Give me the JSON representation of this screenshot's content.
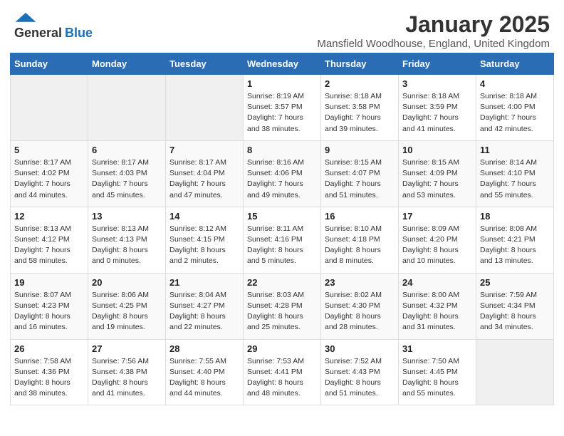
{
  "header": {
    "logo_general": "General",
    "logo_blue": "Blue",
    "title": "January 2025",
    "subtitle": "Mansfield Woodhouse, England, United Kingdom"
  },
  "days_of_week": [
    "Sunday",
    "Monday",
    "Tuesday",
    "Wednesday",
    "Thursday",
    "Friday",
    "Saturday"
  ],
  "weeks": [
    [
      {
        "day": "",
        "info": ""
      },
      {
        "day": "",
        "info": ""
      },
      {
        "day": "",
        "info": ""
      },
      {
        "day": "1",
        "info": "Sunrise: 8:19 AM\nSunset: 3:57 PM\nDaylight: 7 hours\nand 38 minutes."
      },
      {
        "day": "2",
        "info": "Sunrise: 8:18 AM\nSunset: 3:58 PM\nDaylight: 7 hours\nand 39 minutes."
      },
      {
        "day": "3",
        "info": "Sunrise: 8:18 AM\nSunset: 3:59 PM\nDaylight: 7 hours\nand 41 minutes."
      },
      {
        "day": "4",
        "info": "Sunrise: 8:18 AM\nSunset: 4:00 PM\nDaylight: 7 hours\nand 42 minutes."
      }
    ],
    [
      {
        "day": "5",
        "info": "Sunrise: 8:17 AM\nSunset: 4:02 PM\nDaylight: 7 hours\nand 44 minutes."
      },
      {
        "day": "6",
        "info": "Sunrise: 8:17 AM\nSunset: 4:03 PM\nDaylight: 7 hours\nand 45 minutes."
      },
      {
        "day": "7",
        "info": "Sunrise: 8:17 AM\nSunset: 4:04 PM\nDaylight: 7 hours\nand 47 minutes."
      },
      {
        "day": "8",
        "info": "Sunrise: 8:16 AM\nSunset: 4:06 PM\nDaylight: 7 hours\nand 49 minutes."
      },
      {
        "day": "9",
        "info": "Sunrise: 8:15 AM\nSunset: 4:07 PM\nDaylight: 7 hours\nand 51 minutes."
      },
      {
        "day": "10",
        "info": "Sunrise: 8:15 AM\nSunset: 4:09 PM\nDaylight: 7 hours\nand 53 minutes."
      },
      {
        "day": "11",
        "info": "Sunrise: 8:14 AM\nSunset: 4:10 PM\nDaylight: 7 hours\nand 55 minutes."
      }
    ],
    [
      {
        "day": "12",
        "info": "Sunrise: 8:13 AM\nSunset: 4:12 PM\nDaylight: 7 hours\nand 58 minutes."
      },
      {
        "day": "13",
        "info": "Sunrise: 8:13 AM\nSunset: 4:13 PM\nDaylight: 8 hours\nand 0 minutes."
      },
      {
        "day": "14",
        "info": "Sunrise: 8:12 AM\nSunset: 4:15 PM\nDaylight: 8 hours\nand 2 minutes."
      },
      {
        "day": "15",
        "info": "Sunrise: 8:11 AM\nSunset: 4:16 PM\nDaylight: 8 hours\nand 5 minutes."
      },
      {
        "day": "16",
        "info": "Sunrise: 8:10 AM\nSunset: 4:18 PM\nDaylight: 8 hours\nand 8 minutes."
      },
      {
        "day": "17",
        "info": "Sunrise: 8:09 AM\nSunset: 4:20 PM\nDaylight: 8 hours\nand 10 minutes."
      },
      {
        "day": "18",
        "info": "Sunrise: 8:08 AM\nSunset: 4:21 PM\nDaylight: 8 hours\nand 13 minutes."
      }
    ],
    [
      {
        "day": "19",
        "info": "Sunrise: 8:07 AM\nSunset: 4:23 PM\nDaylight: 8 hours\nand 16 minutes."
      },
      {
        "day": "20",
        "info": "Sunrise: 8:06 AM\nSunset: 4:25 PM\nDaylight: 8 hours\nand 19 minutes."
      },
      {
        "day": "21",
        "info": "Sunrise: 8:04 AM\nSunset: 4:27 PM\nDaylight: 8 hours\nand 22 minutes."
      },
      {
        "day": "22",
        "info": "Sunrise: 8:03 AM\nSunset: 4:28 PM\nDaylight: 8 hours\nand 25 minutes."
      },
      {
        "day": "23",
        "info": "Sunrise: 8:02 AM\nSunset: 4:30 PM\nDaylight: 8 hours\nand 28 minutes."
      },
      {
        "day": "24",
        "info": "Sunrise: 8:00 AM\nSunset: 4:32 PM\nDaylight: 8 hours\nand 31 minutes."
      },
      {
        "day": "25",
        "info": "Sunrise: 7:59 AM\nSunset: 4:34 PM\nDaylight: 8 hours\nand 34 minutes."
      }
    ],
    [
      {
        "day": "26",
        "info": "Sunrise: 7:58 AM\nSunset: 4:36 PM\nDaylight: 8 hours\nand 38 minutes."
      },
      {
        "day": "27",
        "info": "Sunrise: 7:56 AM\nSunset: 4:38 PM\nDaylight: 8 hours\nand 41 minutes."
      },
      {
        "day": "28",
        "info": "Sunrise: 7:55 AM\nSunset: 4:40 PM\nDaylight: 8 hours\nand 44 minutes."
      },
      {
        "day": "29",
        "info": "Sunrise: 7:53 AM\nSunset: 4:41 PM\nDaylight: 8 hours\nand 48 minutes."
      },
      {
        "day": "30",
        "info": "Sunrise: 7:52 AM\nSunset: 4:43 PM\nDaylight: 8 hours\nand 51 minutes."
      },
      {
        "day": "31",
        "info": "Sunrise: 7:50 AM\nSunset: 4:45 PM\nDaylight: 8 hours\nand 55 minutes."
      },
      {
        "day": "",
        "info": ""
      }
    ]
  ]
}
